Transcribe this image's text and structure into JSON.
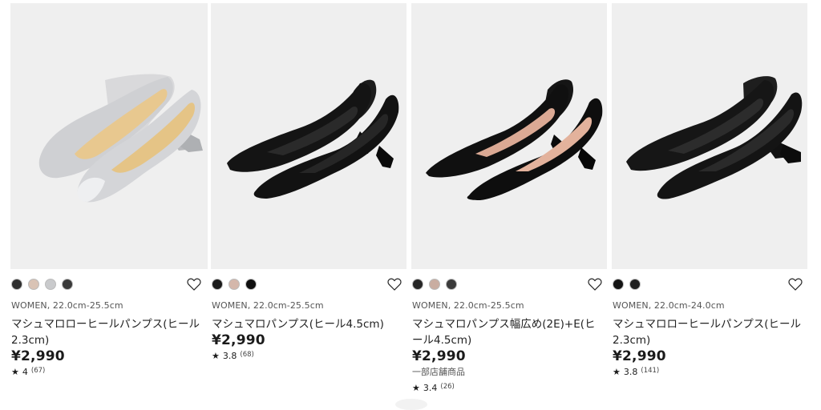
{
  "products": [
    {
      "swatches": [
        "#2f2f2f",
        "#d9c3b5",
        "#c9cacc",
        "#3a3a3a"
      ],
      "gender_size": "WOMEN, 22.0cm-25.5cm",
      "name": "マシュマロローヒールパンプス(ヒール2.3cm)",
      "price": "¥2,990",
      "note": "",
      "rating_star": "★",
      "rating": "4",
      "rating_count": "(67)"
    },
    {
      "swatches": [
        "#1a1a1a",
        "#d4b7ab",
        "#0f0f0f"
      ],
      "gender_size": "WOMEN, 22.0cm-25.5cm",
      "name": "マシュマロパンプス(ヒール4.5cm)",
      "price": "¥2,990",
      "note": "",
      "rating_star": "★",
      "rating": "3.8",
      "rating_count": "(68)"
    },
    {
      "swatches": [
        "#262626",
        "#c9ada1",
        "#3b3b3b"
      ],
      "gender_size": "WOMEN, 22.0cm-25.5cm",
      "name": "マシュマロパンプス幅広め(2E)+E(ヒール4.5cm)",
      "price": "¥2,990",
      "note": "一部店舗商品",
      "rating_star": "★",
      "rating": "3.4",
      "rating_count": "(26)"
    },
    {
      "swatches": [
        "#141414",
        "#202020"
      ],
      "gender_size": "WOMEN, 22.0cm-24.0cm",
      "name": "マシュマロローヒールパンプス(ヒール2.3cm)",
      "price": "¥2,990",
      "note": "",
      "rating_star": "★",
      "rating": "3.8",
      "rating_count": "(141)"
    }
  ],
  "icons": {
    "favorite": "heart-outline-icon",
    "shoe_image": "pumps-product-photo"
  },
  "colors": {
    "photo_bg": "#efefef",
    "text": "#1b1b1b"
  }
}
